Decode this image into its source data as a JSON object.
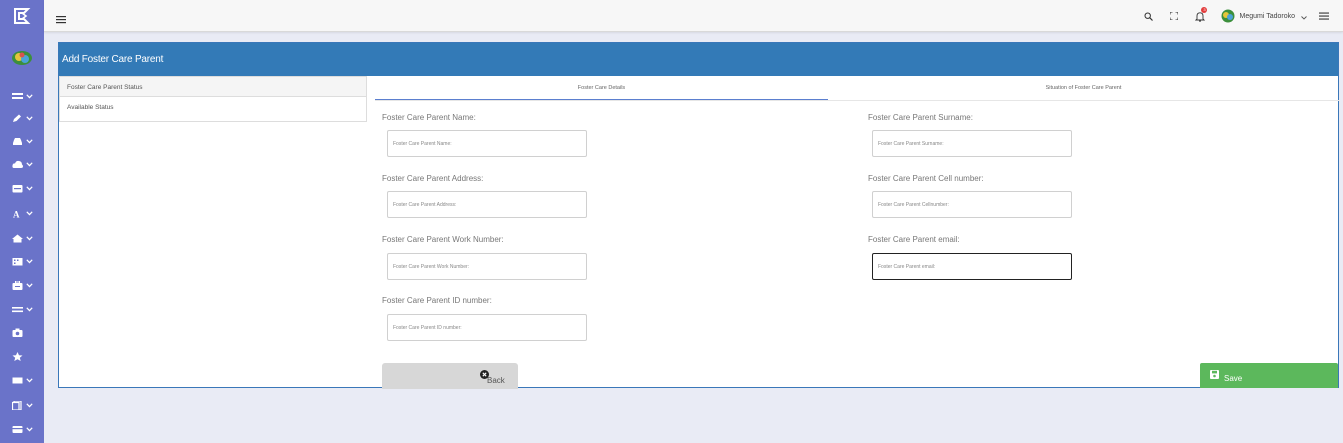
{
  "sidebar": {
    "items": [
      {
        "icon": "list-icon",
        "chevron": true
      },
      {
        "icon": "pencil-icon",
        "chevron": true
      },
      {
        "icon": "car-icon",
        "chevron": true
      },
      {
        "icon": "cloud-icon",
        "chevron": true
      },
      {
        "icon": "calendar-icon",
        "chevron": true
      },
      {
        "icon": "font-icon",
        "chevron": true
      },
      {
        "icon": "home-icon",
        "chevron": true
      },
      {
        "icon": "building-icon",
        "chevron": true
      },
      {
        "icon": "briefcase-icon",
        "chevron": true
      },
      {
        "icon": "equals-icon",
        "chevron": true
      },
      {
        "icon": "camera-icon",
        "chevron": false
      },
      {
        "icon": "star-icon",
        "chevron": false
      },
      {
        "icon": "rectangle-icon",
        "chevron": true
      },
      {
        "icon": "document-icon",
        "chevron": true
      },
      {
        "icon": "card-icon",
        "chevron": true
      }
    ]
  },
  "topbar": {
    "user_name": "Megumi Tadoroko",
    "notification_badge": "3"
  },
  "card": {
    "title": "Add Foster Care Parent"
  },
  "status_list": {
    "items": [
      "Foster Care Parent Status",
      "Available Status"
    ]
  },
  "tabs": [
    "Foster Care Details",
    "Situation of Foster Care Parent"
  ],
  "form": {
    "name": {
      "label": "Foster Care Parent Name:",
      "placeholder": "Foster Care Parent Name:"
    },
    "surname": {
      "label": "Foster Care Parent Surname:",
      "placeholder": "Foster Care Parent Surname:"
    },
    "address": {
      "label": "Foster Care Parent Address:",
      "placeholder": "Foster Care Parent Address:"
    },
    "cell": {
      "label": "Foster Care Parent Cell number:",
      "placeholder": "Foster Care Parent Cellnumber:"
    },
    "work": {
      "label": "Foster Care Parent Work Number:",
      "placeholder": "Foster Care Parent Work Number:"
    },
    "email": {
      "label": "Foster Care Parent email:",
      "placeholder": "Foster Care Parent email:"
    },
    "id_number": {
      "label": "Foster Care Parent ID number:",
      "placeholder": "Foster Care Parent ID number:"
    }
  },
  "buttons": {
    "back": "Back",
    "save": "Save"
  },
  "colors": {
    "sidebar": "#6a73c9",
    "header": "#337ab7",
    "save": "#5cb85c",
    "back": "#d7d7d7"
  }
}
